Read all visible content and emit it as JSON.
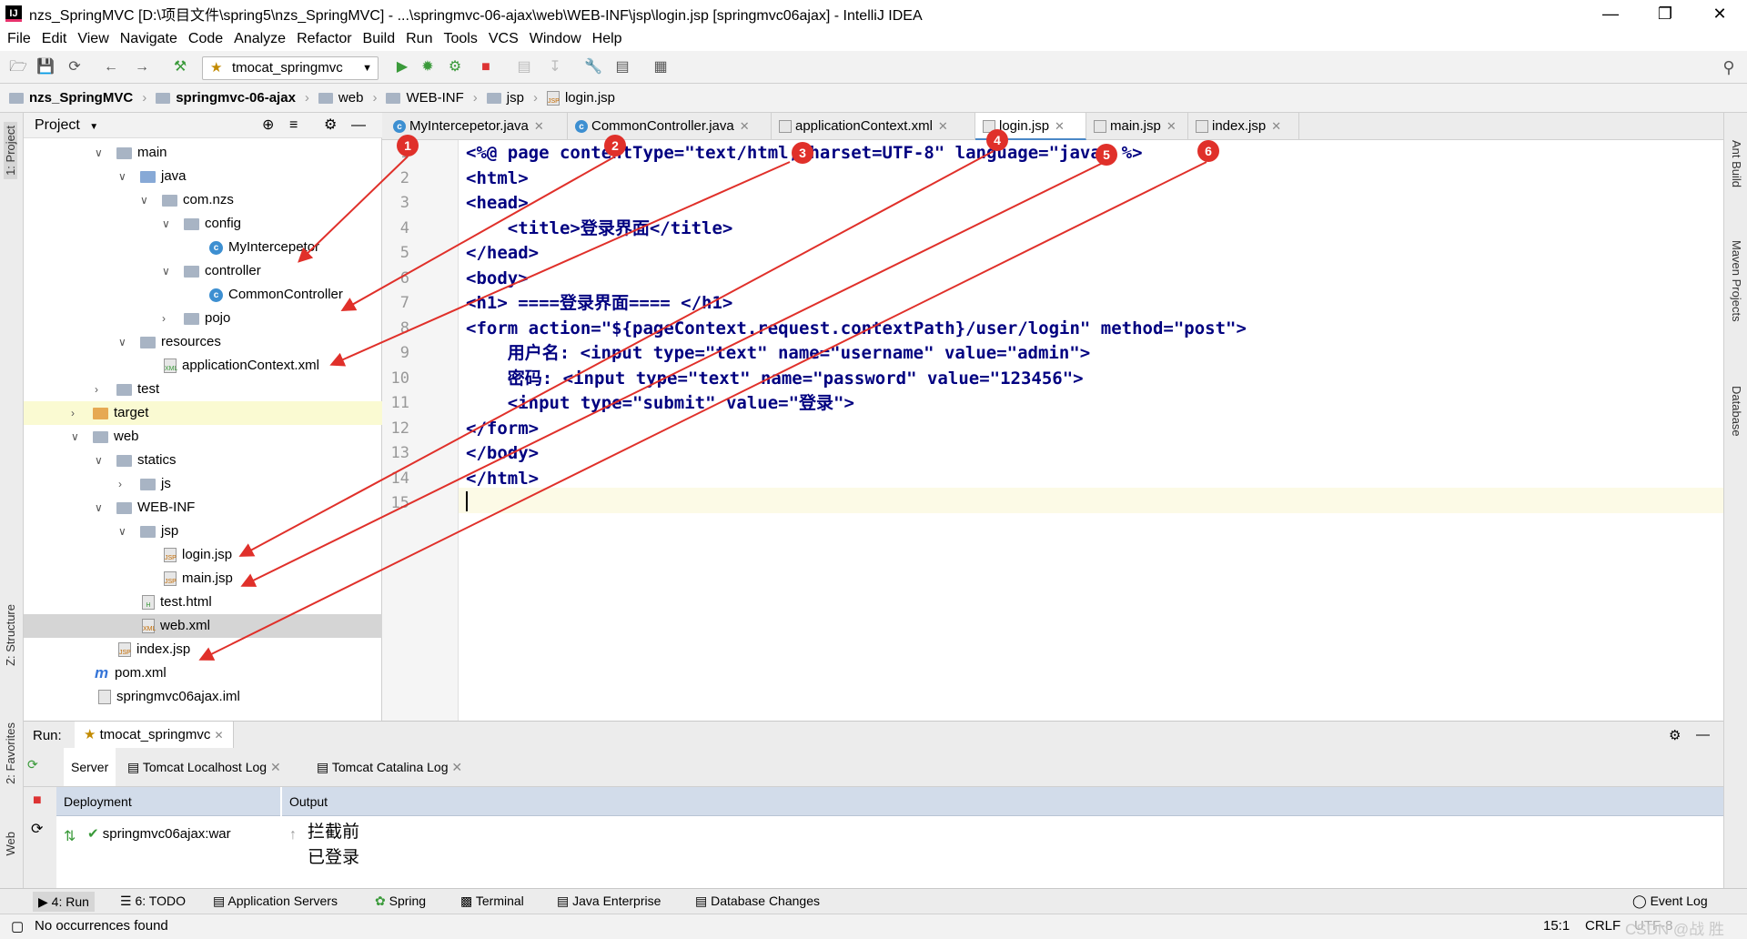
{
  "window": {
    "title": "nzs_SpringMVC [D:\\项目文件\\spring5\\nzs_SpringMVC] - ...\\springmvc-06-ajax\\web\\WEB-INF\\jsp\\login.jsp [springmvc06ajax] - IntelliJ IDEA",
    "app_icon": "IJ"
  },
  "menu": [
    "File",
    "Edit",
    "View",
    "Navigate",
    "Code",
    "Analyze",
    "Refactor",
    "Build",
    "Run",
    "Tools",
    "VCS",
    "Window",
    "Help"
  ],
  "toolbar": {
    "run_config": "tmocat_springmvc"
  },
  "breadcrumb": [
    "nzs_SpringMVC",
    "springmvc-06-ajax",
    "web",
    "WEB-INF",
    "jsp",
    "login.jsp"
  ],
  "project": {
    "header": "Project",
    "tree": [
      {
        "label": "main"
      },
      {
        "label": "java"
      },
      {
        "label": "com.nzs"
      },
      {
        "label": "config"
      },
      {
        "label": "MyIntercepetor"
      },
      {
        "label": "controller"
      },
      {
        "label": "CommonController"
      },
      {
        "label": "pojo"
      },
      {
        "label": "resources"
      },
      {
        "label": "applicationContext.xml"
      },
      {
        "label": "test"
      },
      {
        "label": "target"
      },
      {
        "label": "web"
      },
      {
        "label": "statics"
      },
      {
        "label": "js"
      },
      {
        "label": "WEB-INF"
      },
      {
        "label": "jsp"
      },
      {
        "label": "login.jsp"
      },
      {
        "label": "main.jsp"
      },
      {
        "label": "test.html"
      },
      {
        "label": "web.xml"
      },
      {
        "label": "index.jsp"
      },
      {
        "label": "pom.xml"
      },
      {
        "label": "springmvc06ajax.iml"
      }
    ]
  },
  "tabs": [
    {
      "label": "MyIntercepetor.java"
    },
    {
      "label": "CommonController.java"
    },
    {
      "label": "applicationContext.xml"
    },
    {
      "label": "login.jsp"
    },
    {
      "label": "main.jsp"
    },
    {
      "label": "index.jsp"
    }
  ],
  "editor": {
    "line_numbers": [
      "1",
      "2",
      "3",
      "4",
      "5",
      "6",
      "7",
      "8",
      "9",
      "10",
      "11",
      "12",
      "13",
      "14",
      "15"
    ],
    "lines": [
      "<%@ page contentType=\"text/html;charset=UTF-8\" language=\"java\" %>",
      "<html>",
      "<head>",
      "    <title>登录界面</title>",
      "</head>",
      "<body>",
      "<h1> ====登录界面==== </h1>",
      "<form action=\"${pageContext.request.contextPath}/user/login\" method=\"post\">",
      "    用户名: <input type=\"text\" name=\"username\" value=\"admin\">",
      "    密码: <input type=\"text\" name=\"password\" value=\"123456\">",
      "    <input type=\"submit\" value=\"登录\">",
      "</form>",
      "</body>",
      "</html>",
      ""
    ]
  },
  "annotations": [
    "1",
    "2",
    "3",
    "4",
    "5",
    "6"
  ],
  "run": {
    "label": "Run:",
    "config": "tmocat_springmvc",
    "tabs": [
      "Server",
      "Tomcat Localhost Log",
      "Tomcat Catalina Log"
    ],
    "deployment_header": "Deployment",
    "output_header": "Output",
    "deployment_item": "springmvc06ajax:war",
    "output": [
      "拦截前",
      "已登录"
    ]
  },
  "bottom_tabs": [
    "4: Run",
    "6: TODO",
    "Application Servers",
    "Spring",
    "Terminal",
    "Java Enterprise",
    "Database Changes"
  ],
  "event_log": "Event Log",
  "side_tabs_left": [
    "1: Project",
    "Z: Structure",
    "2: Favorites",
    "Web"
  ],
  "side_tabs_right": [
    "Ant Build",
    "Maven Projects",
    "Database"
  ],
  "status": {
    "message": "No occurrences found",
    "position": "15:1",
    "line_sep": "CRLF",
    "encoding": "UTF-8"
  },
  "watermark": "CSDN @战 胜"
}
